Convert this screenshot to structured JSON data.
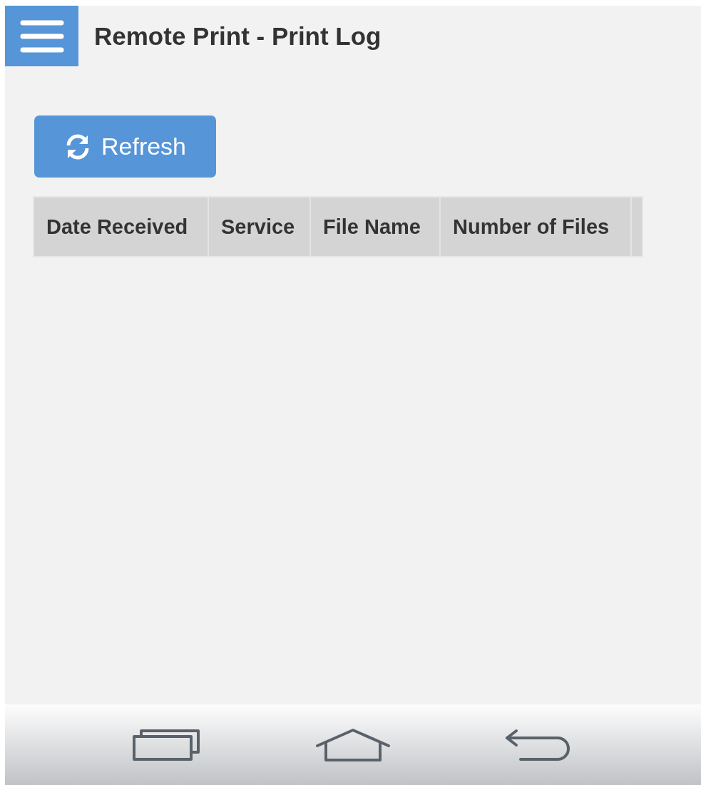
{
  "app_bar": {
    "title": "Remote Print - Print Log"
  },
  "refresh_button": {
    "label": "Refresh"
  },
  "table": {
    "columns": [
      "Date Received",
      "Service",
      "File Name",
      "Number of Files"
    ]
  }
}
